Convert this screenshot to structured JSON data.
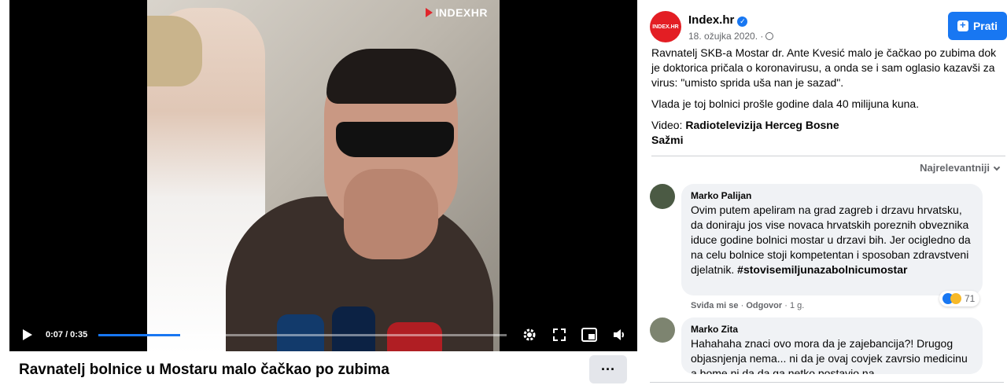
{
  "video": {
    "watermark": "INDEXHR",
    "time": "0:07 / 0:35",
    "progress": 0.2,
    "title": "Ravnatelj bolnice u Mostaru malo čačkao po zubima",
    "more_label": "···"
  },
  "page": {
    "avatar_text": "INDEX.HR",
    "name": "Index.hr",
    "date": "18. ožujka 2020. ·",
    "follow_label": "Prati"
  },
  "post": {
    "paragraph1": "Ravnatelj SKB-a Mostar dr. Ante Kvesić malo je čačkao po zubima dok je doktorica pričala o koronavirusu, a onda se i sam oglasio kazavši za virus: \"umisto sprida uša nan je sazad\".",
    "paragraph2": "Vlada je toj bolnici prošle godine dala 40 milijuna kuna.",
    "video_prefix": "Video: ",
    "video_source": "Radiotelevizija Herceg Bosne",
    "see_less": "Sažmi"
  },
  "comments_sort": "Najrelevantniji",
  "comments": [
    {
      "name": "Marko Palijan",
      "text": "Ovim putem apeliram na grad zagreb i drzavu hrvatsku, da doniraju jos vise novaca hrvatskih poreznih obveznika iduce godine bolnici mostar u drzavi bih. Jer ocigledno da na celu bolnice stoji kompetentan i sposoban zdravstveni djelatnik.",
      "hashtag": "#stovisemiljunazabolnicumostar",
      "like": "Sviđa mi se",
      "reply": "Odgovor",
      "age": "1 g.",
      "reactions": "71"
    },
    {
      "name": "Marko Zita",
      "text": "Hahahaha znaci ovo mora da je zajebancija?! Drugog objasnjenja nema... ni da je ovaj covjek zavrsio medicinu a bome ni da da ga netko postavio na"
    }
  ],
  "colors": {
    "accent": "#1877f2",
    "brand": "#e31e24",
    "bubble": "#f0f2f5"
  }
}
